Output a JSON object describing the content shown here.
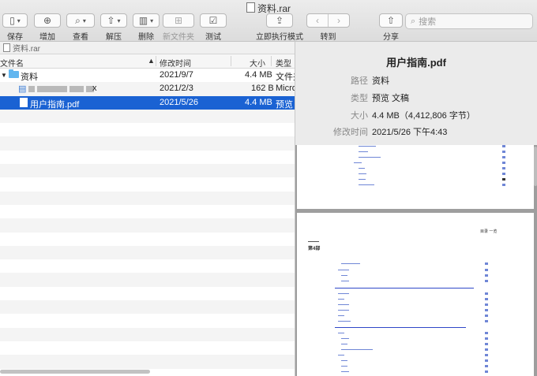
{
  "window": {
    "title": "资料.rar"
  },
  "toolbar": {
    "save": "保存",
    "add": "增加",
    "view": "查看",
    "extract": "解压",
    "delete": "删除",
    "new_folder": "新文件夹",
    "test": "测试",
    "run_now": "立即执行模式",
    "goto": "转到",
    "share": "分享"
  },
  "search": {
    "placeholder": "搜索"
  },
  "pathbar": {
    "label": "资料.rar"
  },
  "columns": {
    "name": "文件名",
    "modified": "修改时间",
    "size": "大小",
    "type": "类型"
  },
  "rows": [
    {
      "name": "资料",
      "date": "2021/9/7",
      "size": "4.4 MB",
      "type": "文件夹"
    },
    {
      "name_suffix": "x",
      "date": "2021/2/3",
      "size": "162 B",
      "type": "Micro"
    },
    {
      "name": "用户指南.pdf",
      "date": "2021/5/26",
      "size": "4.4 MB",
      "type": "预览"
    }
  ],
  "info": {
    "title": "用户指南.pdf",
    "path_label": "路径",
    "path": "资料",
    "type_label": "类型",
    "type": "预览 文稿",
    "size_label": "大小",
    "size": "4.4 MB（4,412,806 字节）",
    "modified_label": "修改时间",
    "modified": "2021/5/26 下午4:43"
  },
  "preview": {
    "page_header": "目录 一览",
    "chapter": "第4部"
  }
}
